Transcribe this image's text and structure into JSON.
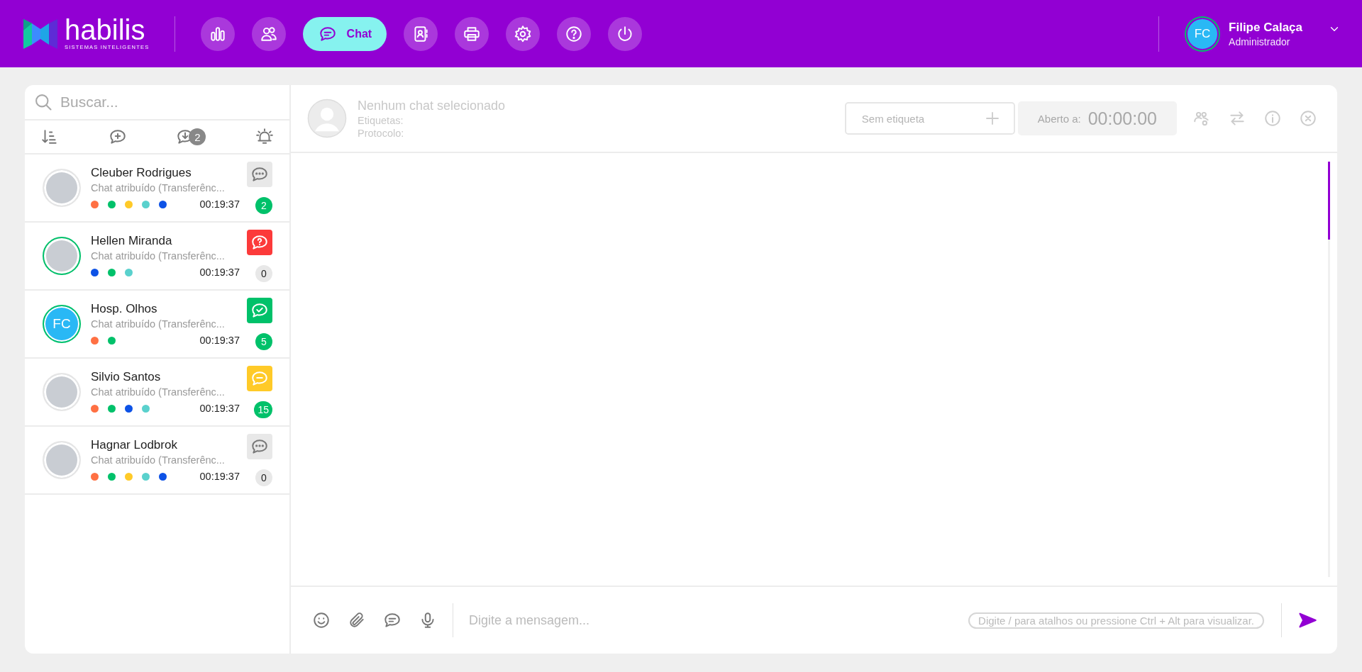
{
  "logo": {
    "name": "habilis",
    "tagline": "SISTEMAS INTELIGENTES"
  },
  "nav": [
    {
      "kind": "dashboard",
      "selected": false
    },
    {
      "kind": "contacts",
      "selected": false
    },
    {
      "kind": "chat",
      "label": "Chat",
      "selected": true
    },
    {
      "kind": "agenda",
      "selected": false
    },
    {
      "kind": "print",
      "selected": false
    },
    {
      "kind": "settings",
      "selected": false
    },
    {
      "kind": "help",
      "selected": false
    },
    {
      "kind": "power",
      "selected": false
    }
  ],
  "user": {
    "initials": "FC",
    "name": "Filipe Calaça",
    "role": "Administrador"
  },
  "search": {
    "placeholder": "Buscar..."
  },
  "toolbar": [
    {
      "kind": "sort"
    },
    {
      "kind": "new-chat"
    },
    {
      "kind": "incoming",
      "badge": "2"
    },
    {
      "kind": "alert"
    }
  ],
  "chats": [
    {
      "name": "Cleuber Rodrigues",
      "preview": "Chat atribuído (Transferênc...",
      "time": "00:19:37",
      "count": "2",
      "unread": true,
      "online": false,
      "status": {
        "kind": "waiting",
        "color": "#e8e8e8"
      },
      "tags": [
        {
          "color": "#ff7043"
        },
        {
          "color": "#00c16a"
        },
        {
          "color": "#ffca28"
        },
        {
          "color": "#5ad1cd"
        },
        {
          "color": "#0d52e6"
        }
      ]
    },
    {
      "name": "Hellen Miranda",
      "preview": "Chat atribuído (Transferênc...",
      "time": "00:19:37",
      "count": "0",
      "unread": false,
      "online": true,
      "status": {
        "kind": "question",
        "color": "#fc3a3a"
      },
      "tags": [
        {
          "color": "#0d52e6"
        },
        {
          "color": "#00c16a"
        },
        {
          "color": "#5ad1cd"
        }
      ]
    },
    {
      "name": "Hosp. Olhos",
      "preview": "Chat atribuído (Transferênc...",
      "time": "00:19:37",
      "count": "5",
      "unread": true,
      "online": true,
      "initials": "FC",
      "status": {
        "kind": "done",
        "color": "#00c16a"
      },
      "tags": [
        {
          "color": "#ff7043"
        },
        {
          "color": "#00c16a"
        }
      ]
    },
    {
      "name": "Silvio Santos",
      "preview": "Chat atribuído (Transferênc...",
      "time": "00:19:37",
      "count": "15",
      "unread": true,
      "online": false,
      "status": {
        "kind": "paused",
        "color": "#ffca28"
      },
      "tags": [
        {
          "color": "#ff7043"
        },
        {
          "color": "#00c16a"
        },
        {
          "color": "#0d52e6"
        },
        {
          "color": "#5ad1cd"
        }
      ]
    },
    {
      "name": "Hagnar Lodbrok",
      "preview": "Chat atribuído (Transferênc...",
      "time": "00:19:37",
      "count": "0",
      "unread": false,
      "online": false,
      "status": {
        "kind": "waiting",
        "color": "#e8e8e8"
      },
      "tags": [
        {
          "color": "#ff7043"
        },
        {
          "color": "#00c16a"
        },
        {
          "color": "#ffca28"
        },
        {
          "color": "#5ad1cd"
        },
        {
          "color": "#0d52e6"
        }
      ]
    }
  ],
  "conversation": {
    "title": "Nenhum chat selecionado",
    "labels_caption": "Etiquetas:",
    "protocol_caption": "Protocolo:",
    "tag_field": {
      "placeholder": "Sem etiqueta"
    },
    "timer": {
      "caption": "Aberto a:",
      "value": "00:00:00"
    },
    "actions": [
      {
        "kind": "team"
      },
      {
        "kind": "transfer"
      },
      {
        "kind": "info"
      },
      {
        "kind": "close"
      }
    ]
  },
  "composer": {
    "tools": [
      {
        "kind": "emoji"
      },
      {
        "kind": "attach"
      },
      {
        "kind": "quick-reply"
      },
      {
        "kind": "mic"
      }
    ],
    "placeholder": "Digite a mensagem...",
    "hint": "Digite / para atalhos ou pressione Ctrl + Alt para visualizar."
  }
}
